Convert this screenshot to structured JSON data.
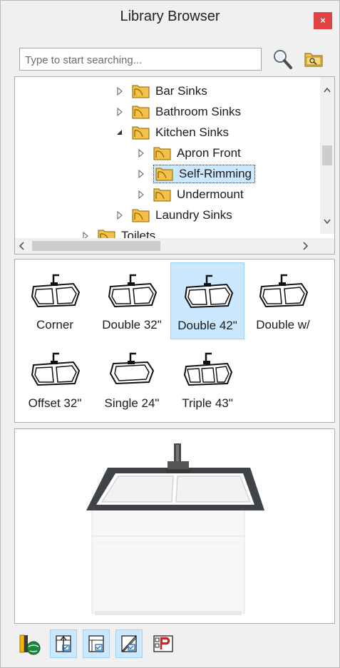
{
  "window": {
    "title": "Library Browser",
    "close_label": "×"
  },
  "search": {
    "placeholder": "Type to start searching..."
  },
  "icons": {
    "search": "magnifier-icon",
    "folder": "folder-search-icon",
    "expand": "triangle-right-icon",
    "collapse": "triangle-down-icon"
  },
  "tree": {
    "items": [
      {
        "label": "Bar Sinks",
        "level": 1,
        "state": "collapsed"
      },
      {
        "label": "Bathroom Sinks",
        "level": 1,
        "state": "collapsed"
      },
      {
        "label": "Kitchen Sinks",
        "level": 1,
        "state": "expanded"
      },
      {
        "label": "Apron Front",
        "level": 2,
        "state": "collapsed"
      },
      {
        "label": "Self-Rimming",
        "level": 2,
        "state": "collapsed",
        "selected": true
      },
      {
        "label": "Undermount",
        "level": 2,
        "state": "collapsed"
      },
      {
        "label": "Laundry Sinks",
        "level": 1,
        "state": "collapsed"
      },
      {
        "label": "Toilets",
        "level": 0,
        "state": "collapsed"
      }
    ]
  },
  "gallery": {
    "items": [
      {
        "label": "Corner"
      },
      {
        "label": "Double 32\""
      },
      {
        "label": "Double 42\"",
        "selected": true
      },
      {
        "label": "Double w/"
      },
      {
        "label": "Offset 32\""
      },
      {
        "label": "Single 24\""
      },
      {
        "label": "Triple 43\""
      }
    ]
  },
  "colors": {
    "selection": "#cce8ff",
    "close": "#e04343",
    "folder": "#e6a817"
  },
  "toolbar": {
    "buttons": [
      {
        "name": "library-globe-icon",
        "active": false
      },
      {
        "name": "import-upward-icon",
        "active": true
      },
      {
        "name": "checklist-icon",
        "active": true
      },
      {
        "name": "pencil-check-icon",
        "active": true
      },
      {
        "name": "plan-view-icon",
        "active": false
      }
    ]
  }
}
